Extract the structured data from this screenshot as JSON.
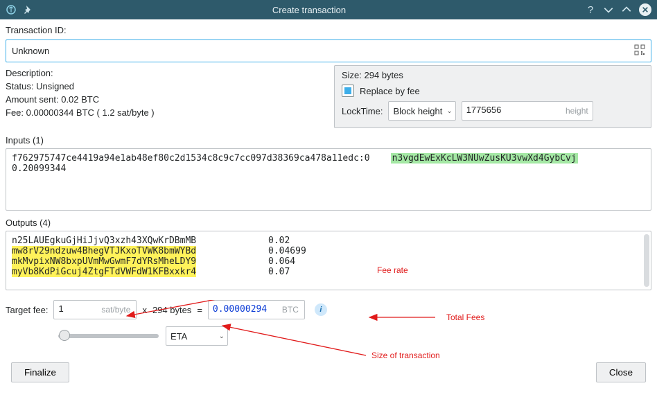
{
  "window": {
    "title": "Create transaction"
  },
  "txid": {
    "label": "Transaction ID:",
    "value": "Unknown"
  },
  "left": {
    "description": "Description:",
    "status": "Status: Unsigned",
    "amount": "Amount sent: 0.02 BTC",
    "fee": "Fee: 0.00000344 BTC  ( 1.2 sat/byte )"
  },
  "right": {
    "size": "Size: 294 bytes",
    "rbf": "Replace by fee",
    "locktime_label": "LockTime:",
    "locktime_mode": "Block height",
    "locktime_value": "1775656",
    "locktime_hint": "height"
  },
  "inputs": {
    "header": "Inputs (1)",
    "txref": "f762975747ce4419a94e1ab48ef80c2d1534c8c9c7cc097d38369ca478a11edc:0",
    "addr": "n3vgdEwExKcLW3NUwZusKU3vwXd4GybCvj",
    "amount": "0.20099344"
  },
  "outputs": {
    "header": "Outputs (4)",
    "rows": [
      {
        "addr": "n25LAUEgkuGjHiJjvQ3xzh43XQwKrDBmMB",
        "val": "0.02",
        "hl": false
      },
      {
        "addr": "mw8rV29ndzuw4BhegVTJKxoTVWK8bmWYBd",
        "val": "0.04699",
        "hl": true
      },
      {
        "addr": "mkMvpixNW8bxpUVmMwGwmF7dYRsMheLDY9",
        "val": "0.064",
        "hl": true
      },
      {
        "addr": "myVb8KdPiGcuj4ZtgFTdVWFdW1KFBxxkr4",
        "val": "0.07",
        "hl": true
      }
    ]
  },
  "targetfee": {
    "label": "Target fee:",
    "rate": "1",
    "rate_unit": "sat/byte",
    "x": "x",
    "size": "294 bytes",
    "eq": "=",
    "total": "0.00000294",
    "total_unit": "BTC",
    "eta": "ETA"
  },
  "buttons": {
    "finalize": "Finalize",
    "close": "Close"
  },
  "annot": {
    "feerate": "Fee rate",
    "totalfees": "Total Fees",
    "sizeoftx": "Size of transaction"
  }
}
